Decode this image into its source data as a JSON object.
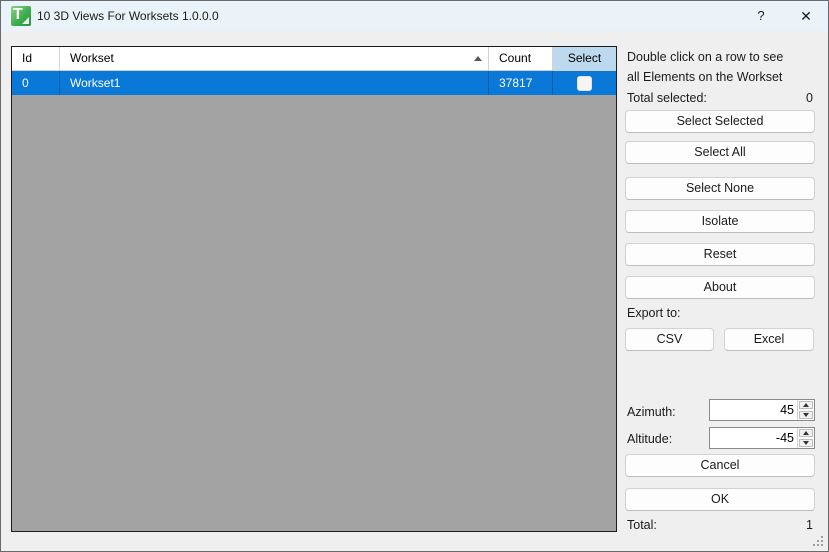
{
  "window": {
    "title": "10 3D Views For Worksets 1.0.0.0",
    "icon_glyph": "T",
    "help_glyph": "?",
    "close_glyph": "✕"
  },
  "grid": {
    "columns": [
      "Id",
      "Workset",
      "Count",
      "Select"
    ],
    "sorted_column": "Workset",
    "sort_direction": "ascending",
    "rows": [
      {
        "id": "0",
        "workset": "Workset1",
        "count": "37817",
        "selected": false
      }
    ]
  },
  "panel": {
    "instruction_line1": "Double click on a row to see",
    "instruction_line2": "all Elements on the Workset",
    "total_selected_label": "Total selected:",
    "total_selected_value": "0",
    "action_buttons": [
      {
        "label": "Select Selected"
      },
      {
        "label": "Select All"
      },
      {
        "label": "Select None"
      },
      {
        "label": "Isolate"
      },
      {
        "label": "Reset"
      },
      {
        "label": "About"
      }
    ],
    "export_label": "Export to:",
    "export_buttons": [
      {
        "label": "CSV"
      },
      {
        "label": "Excel"
      }
    ],
    "azimuth_label": "Azimuth:",
    "azimuth_value": "45",
    "altitude_label": "Altitude:",
    "altitude_value": "-45",
    "cancel_label": "Cancel",
    "ok_label": "OK",
    "total_label": "Total:",
    "total_value": "1"
  },
  "colors": {
    "titlebar_bg": "#ebf3fa",
    "dialog_bg": "#efefef",
    "grid_empty_bg": "#a3a3a3",
    "selection_blue": "#0a78d7",
    "selected_column_header_bg": "#bcd9ee",
    "accent_green": "#3fae4e"
  }
}
